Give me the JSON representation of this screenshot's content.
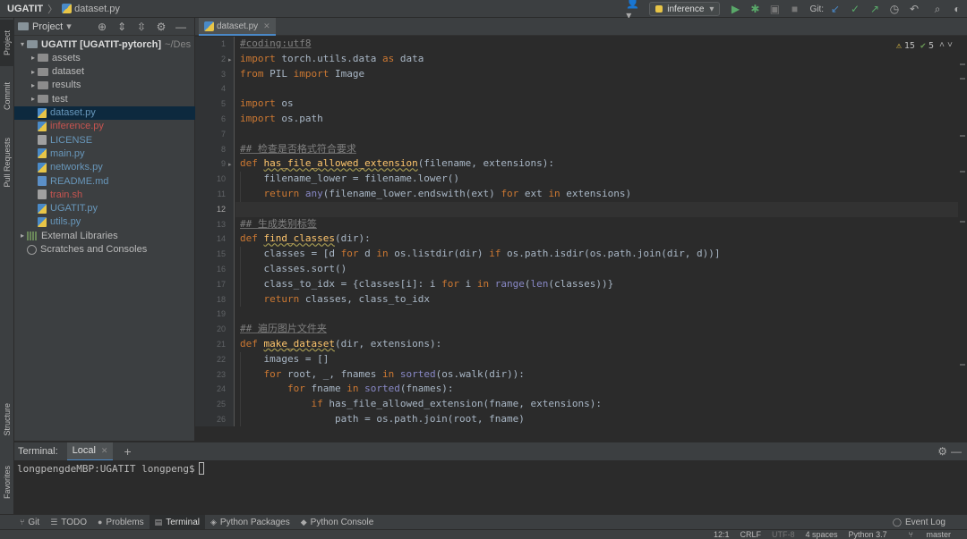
{
  "nav": {
    "project": "UGATIT",
    "file": "dataset.py"
  },
  "toolbar": {
    "run_config": "inference",
    "git_label": "Git:"
  },
  "left_tabs": [
    "Project",
    "Commit",
    "Pull Requests",
    "Structure",
    "Favorites"
  ],
  "project_panel": {
    "title": "Project",
    "root": {
      "name": "UGATIT [UGATIT-pytorch]",
      "path": "~/Des"
    },
    "items": [
      {
        "label": "assets",
        "kind": "folder",
        "color": "#bbbbbb"
      },
      {
        "label": "dataset",
        "kind": "folder",
        "color": "#bbbbbb"
      },
      {
        "label": "results",
        "kind": "folder",
        "color": "#bbbbbb"
      },
      {
        "label": "test",
        "kind": "folder",
        "color": "#bbbbbb"
      },
      {
        "label": "dataset.py",
        "kind": "py",
        "color": "#6897bb"
      },
      {
        "label": "inference.py",
        "kind": "py",
        "color": "#c75450"
      },
      {
        "label": "LICENSE",
        "kind": "txt",
        "color": "#6897bb"
      },
      {
        "label": "main.py",
        "kind": "py",
        "color": "#6897bb"
      },
      {
        "label": "networks.py",
        "kind": "py",
        "color": "#6897bb"
      },
      {
        "label": "README.md",
        "kind": "md",
        "color": "#6897bb"
      },
      {
        "label": "train.sh",
        "kind": "sh",
        "color": "#c75450"
      },
      {
        "label": "UGATIT.py",
        "kind": "py",
        "color": "#6897bb"
      },
      {
        "label": "utils.py",
        "kind": "py",
        "color": "#6897bb"
      }
    ],
    "external_libraries": "External Libraries",
    "scratches": "Scratches and Consoles"
  },
  "editor": {
    "tab": "dataset.py",
    "warnings": "15",
    "ok_count": "5",
    "current_line": 12
  },
  "code_lines": [
    "#coding:utf8",
    "import torch.utils.data as data",
    "from PIL import Image",
    "",
    "import os",
    "import os.path",
    "",
    "## 检查是否格式符合要求",
    "def has_file_allowed_extension(filename, extensions):",
    "    filename_lower = filename.lower()",
    "    return any(filename_lower.endswith(ext) for ext in extensions)",
    "",
    "## 生成类别标签",
    "def find_classes(dir):",
    "    classes = [d for d in os.listdir(dir) if os.path.isdir(os.path.join(dir, d))]",
    "    classes.sort()",
    "    class_to_idx = {classes[i]: i for i in range(len(classes))}",
    "    return classes, class_to_idx",
    "",
    "## 遍历图片文件夹",
    "def make_dataset(dir, extensions):",
    "    images = []",
    "    for root, _, fnames in sorted(os.walk(dir)):",
    "        for fname in sorted(fnames):",
    "            if has_file_allowed_extension(fname, extensions):",
    "                path = os.path.join(root, fname)"
  ],
  "terminal": {
    "title": "Terminal:",
    "tab": "Local",
    "prompt": "longpengdeMBP:UGATIT longpeng$"
  },
  "bottom_tools": [
    {
      "label": "Git",
      "icon": "git-branch-icon"
    },
    {
      "label": "TODO",
      "icon": "list-icon"
    },
    {
      "label": "Problems",
      "icon": "problems-icon"
    },
    {
      "label": "Terminal",
      "icon": "terminal-icon"
    },
    {
      "label": "Python Packages",
      "icon": "packages-icon"
    },
    {
      "label": "Python Console",
      "icon": "python-icon"
    }
  ],
  "event_log": "Event Log",
  "status": {
    "position": "12:1",
    "line_sep": "CRLF",
    "encoding": "UTF-8",
    "indent": "4 spaces",
    "interpreter": "Python 3.7",
    "branch": "master"
  }
}
